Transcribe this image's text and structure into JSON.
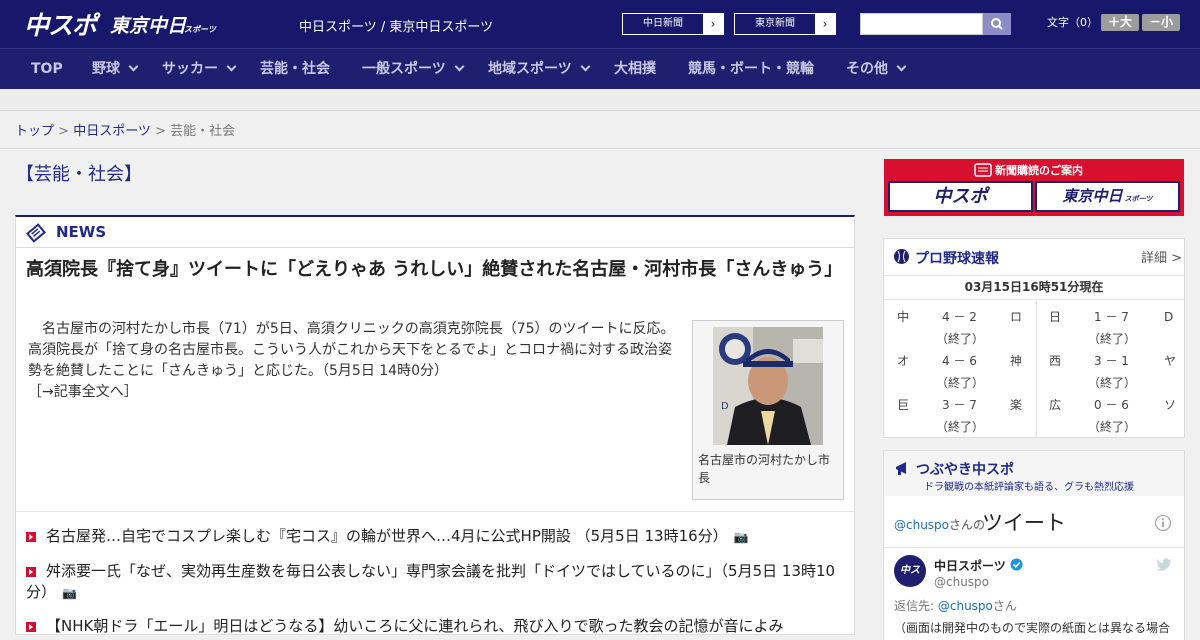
{
  "header": {
    "logo_main": "中スポ",
    "logo_tokyo": "東京中日",
    "logo_sports": "スポーツ",
    "site_title": "中日スポーツ / 東京中日スポーツ",
    "btn_chunichi": "中日新聞",
    "btn_tokyo": "東京新聞",
    "arrow": "›",
    "search_placeholder": "",
    "font_label": "文字（0）",
    "font_big": "＋大",
    "font_small": "－小"
  },
  "nav": {
    "items": [
      "TOP",
      "野球",
      "サッカー",
      "芸能・社会",
      "一般スポーツ",
      "地域スポーツ",
      "大相撲",
      "競馬・ボート・競輪",
      "その他"
    ]
  },
  "breadcrumb": {
    "top": "トップ",
    "sep": " > ",
    "chunichi": "中日スポーツ",
    "current": "芸能・社会"
  },
  "page_title": "【芸能・社会】",
  "news": {
    "label": "NEWS",
    "headline": "高須院長『捨て身』ツイートに「どえりゃあ うれしい」絶賛された名古屋・河村市長「さんきゅう」",
    "lead": "名古屋市の河村たかし市長（71）が5日、高須クリニックの高須克弥院長（75）のツイートに反応。高須院長が「捨て身の名古屋市長。こういう人がこれから天下をとるでよ」とコロナ禍に対する政治姿勢を絶賛したことに「さんきゅう」と応じた。（5月5日 14時0分）",
    "more": "［→記事全文へ］",
    "photo_caption": "名古屋市の河村たかし市長",
    "items": [
      "名古屋発…自宅でコスプレ楽しむ『宅コス』の輪が世界へ…4月に公式HP開設 （5月5日 13時16分）",
      "舛添要一氏「なぜ、実効再生産数を毎日公表しない」専門家会議を批判「ドイツではしているのに」（5月5日 13時10分）",
      "【NHK朝ドラ「エール」明日はどうなる】幼いころに父に連れられ、飛び入りで歌った教会の記憶が音によみ"
    ]
  },
  "subscribe": {
    "title": "新聞購読のご案内",
    "btn1": "中スポ",
    "btn2": "東京中日",
    "btn2_sub": "スポーツ"
  },
  "pro_baseball": {
    "title": "プロ野球速報",
    "detail": "詳細 >",
    "time": "03月15日16時51分現在",
    "left": [
      {
        "home": "中",
        "score": "4 － 2",
        "away": "ロ",
        "status": "（終了）"
      },
      {
        "home": "オ",
        "score": "4 － 6",
        "away": "神",
        "status": "（終了）"
      },
      {
        "home": "巨",
        "score": "3 － 7",
        "away": "楽",
        "status": "（終了）"
      }
    ],
    "right": [
      {
        "home": "日",
        "score": "1 － 7",
        "away": "D",
        "status": "（終了）"
      },
      {
        "home": "西",
        "score": "3 － 1",
        "away": "ヤ",
        "status": "（終了）"
      },
      {
        "home": "広",
        "score": "0 － 6",
        "away": "ソ",
        "status": "（終了）"
      }
    ]
  },
  "tweets": {
    "title": "つぶやき中スポ",
    "subtitle": "ドラ観戦の本紙評論家も語る、グラも熱烈応援",
    "handle_link": "@chuspo",
    "handle_suffix": "さんの",
    "tweet_word": "ツイート",
    "name": "中日スポーツ",
    "handle": "@chuspo",
    "reply_label": "返信先: ",
    "reply_to": "@chuspo",
    "reply_suffix": "さん",
    "text": "（画面は開発中のもので実際の紙面とは異なる場合"
  },
  "colors": {
    "header_bg": "#17186b",
    "nav_bg": "#1f1f70",
    "accent_red": "#d81030",
    "link": "#1f2a8a"
  }
}
